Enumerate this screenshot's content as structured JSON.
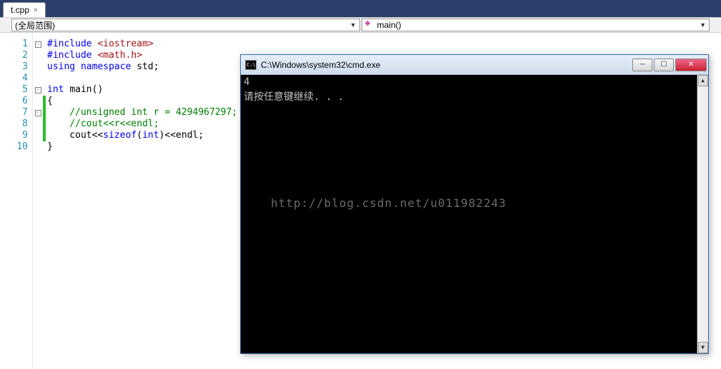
{
  "tab": {
    "label": "t.cpp",
    "close": "×"
  },
  "toolbar": {
    "scope_label": "(全局范围)",
    "func_label": "main()",
    "arrow": "▼"
  },
  "code": {
    "lines": [
      {
        "n": 1,
        "fold": "box",
        "chg": false,
        "segs": [
          {
            "t": "#include ",
            "c": "kw"
          },
          {
            "t": "<iostream>",
            "c": "str"
          }
        ]
      },
      {
        "n": 2,
        "fold": "",
        "chg": false,
        "segs": [
          {
            "t": "#include ",
            "c": "kw"
          },
          {
            "t": "<math.h>",
            "c": "str"
          }
        ]
      },
      {
        "n": 3,
        "fold": "",
        "chg": false,
        "segs": [
          {
            "t": "using namespace ",
            "c": "kw"
          },
          {
            "t": "std;",
            "c": "plain"
          }
        ]
      },
      {
        "n": 4,
        "fold": "",
        "chg": false,
        "segs": []
      },
      {
        "n": 5,
        "fold": "box",
        "chg": false,
        "segs": [
          {
            "t": "int ",
            "c": "kw"
          },
          {
            "t": "main()",
            "c": "plain"
          }
        ]
      },
      {
        "n": 6,
        "fold": "",
        "chg": true,
        "segs": [
          {
            "t": "{",
            "c": "plain"
          }
        ]
      },
      {
        "n": 7,
        "fold": "box",
        "chg": true,
        "segs": [
          {
            "t": "    ",
            "c": "plain"
          },
          {
            "t": "//unsigned int r = 4294967297;",
            "c": "cmt"
          }
        ]
      },
      {
        "n": 8,
        "fold": "",
        "chg": true,
        "segs": [
          {
            "t": "    ",
            "c": "plain"
          },
          {
            "t": "//cout<<r<<endl;",
            "c": "cmt"
          }
        ]
      },
      {
        "n": 9,
        "fold": "",
        "chg": true,
        "segs": [
          {
            "t": "    cout<<",
            "c": "plain"
          },
          {
            "t": "sizeof",
            "c": "kw"
          },
          {
            "t": "(",
            "c": "plain"
          },
          {
            "t": "int",
            "c": "kw"
          },
          {
            "t": ")<<endl;",
            "c": "plain"
          }
        ]
      },
      {
        "n": 10,
        "fold": "",
        "chg": false,
        "segs": [
          {
            "t": "}",
            "c": "plain"
          }
        ]
      }
    ]
  },
  "cmd": {
    "icon_text": "C:\\",
    "title": "C:\\Windows\\system32\\cmd.exe",
    "min": "─",
    "max": "☐",
    "close": "✕",
    "output": [
      "4",
      "请按任意键继续. . ."
    ],
    "scroll_up": "▲",
    "scroll_down": "▼",
    "watermark": "http://blog.csdn.net/u011982243"
  }
}
